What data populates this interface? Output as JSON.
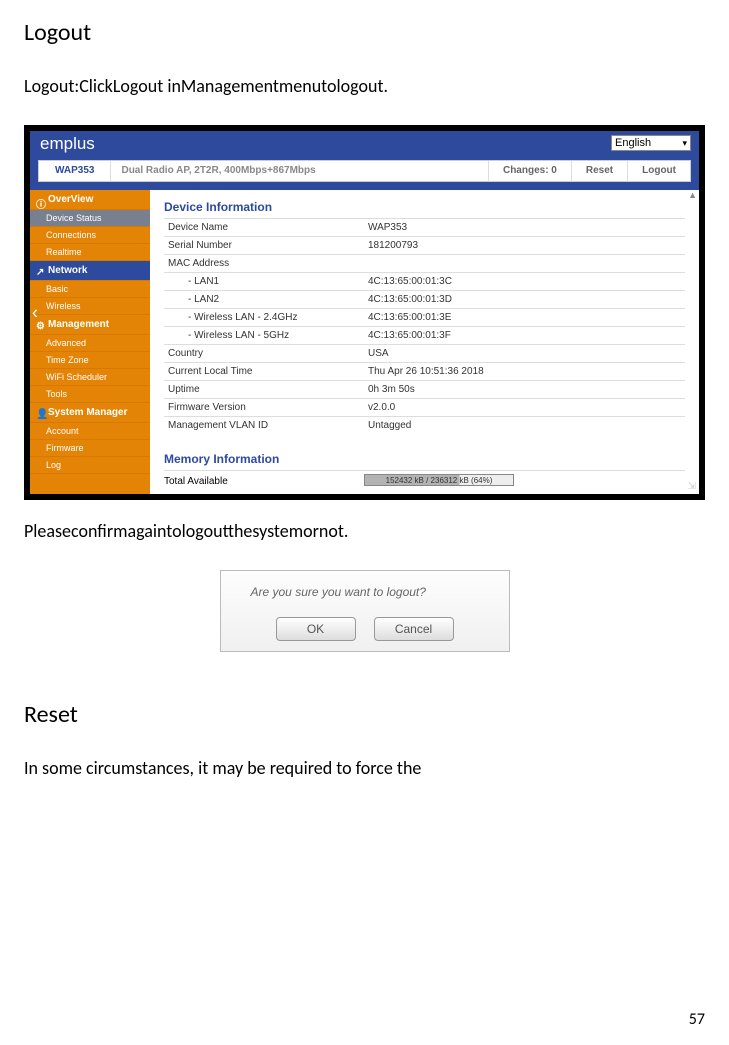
{
  "heading1": "Logout",
  "para1": "Logout:ClickLogout inManagementmenutologout.",
  "para2": "Pleaseconfirmagaintologoutthesystemornot.",
  "heading2": "Reset",
  "para3": "In some circumstances, it may be required to force the",
  "page_number": "57",
  "shot": {
    "brand": "emplus",
    "language": "English",
    "device_model": "WAP353",
    "device_desc": "Dual Radio AP, 2T2R, 400Mbps+867Mbps",
    "changes_label": "Changes: 0",
    "reset_label": "Reset",
    "logout_label": "Logout",
    "sidebar": {
      "overview": "OverView",
      "device_status": "Device Status",
      "connections": "Connections",
      "realtime": "Realtime",
      "network": "Network",
      "basic": "Basic",
      "wireless": "Wireless",
      "management": "Management",
      "advanced": "Advanced",
      "time_zone": "Time Zone",
      "wifi_scheduler": "WiFi Scheduler",
      "tools": "Tools",
      "system_manager": "System Manager",
      "account": "Account",
      "firmware": "Firmware",
      "log": "Log"
    },
    "content": {
      "title": "Device Information",
      "rows": {
        "device_name_l": "Device Name",
        "device_name_v": "WAP353",
        "serial_l": "Serial Number",
        "serial_v": "181200793",
        "mac_l": "MAC Address",
        "mac_v": "",
        "lan1_l": "- LAN1",
        "lan1_v": "4C:13:65:00:01:3C",
        "lan2_l": "- LAN2",
        "lan2_v": "4C:13:65:00:01:3D",
        "w24_l": "- Wireless LAN - 2.4GHz",
        "w24_v": "4C:13:65:00:01:3E",
        "w5_l": "- Wireless LAN - 5GHz",
        "w5_v": "4C:13:65:00:01:3F",
        "country_l": "Country",
        "country_v": "USA",
        "time_l": "Current Local Time",
        "time_v": "Thu Apr 26 10:51:36 2018",
        "uptime_l": "Uptime",
        "uptime_v": "0h 3m 50s",
        "fw_l": "Firmware Version",
        "fw_v": "v2.0.0",
        "vlan_l": "Management VLAN ID",
        "vlan_v": "Untagged"
      },
      "mem_title": "Memory Information",
      "mem_label": "Total Available",
      "mem_bar_text": "152432 kB / 236312 kB (64%)"
    }
  },
  "dialog": {
    "text": "Are you sure you want to logout?",
    "ok": "OK",
    "cancel": "Cancel"
  }
}
